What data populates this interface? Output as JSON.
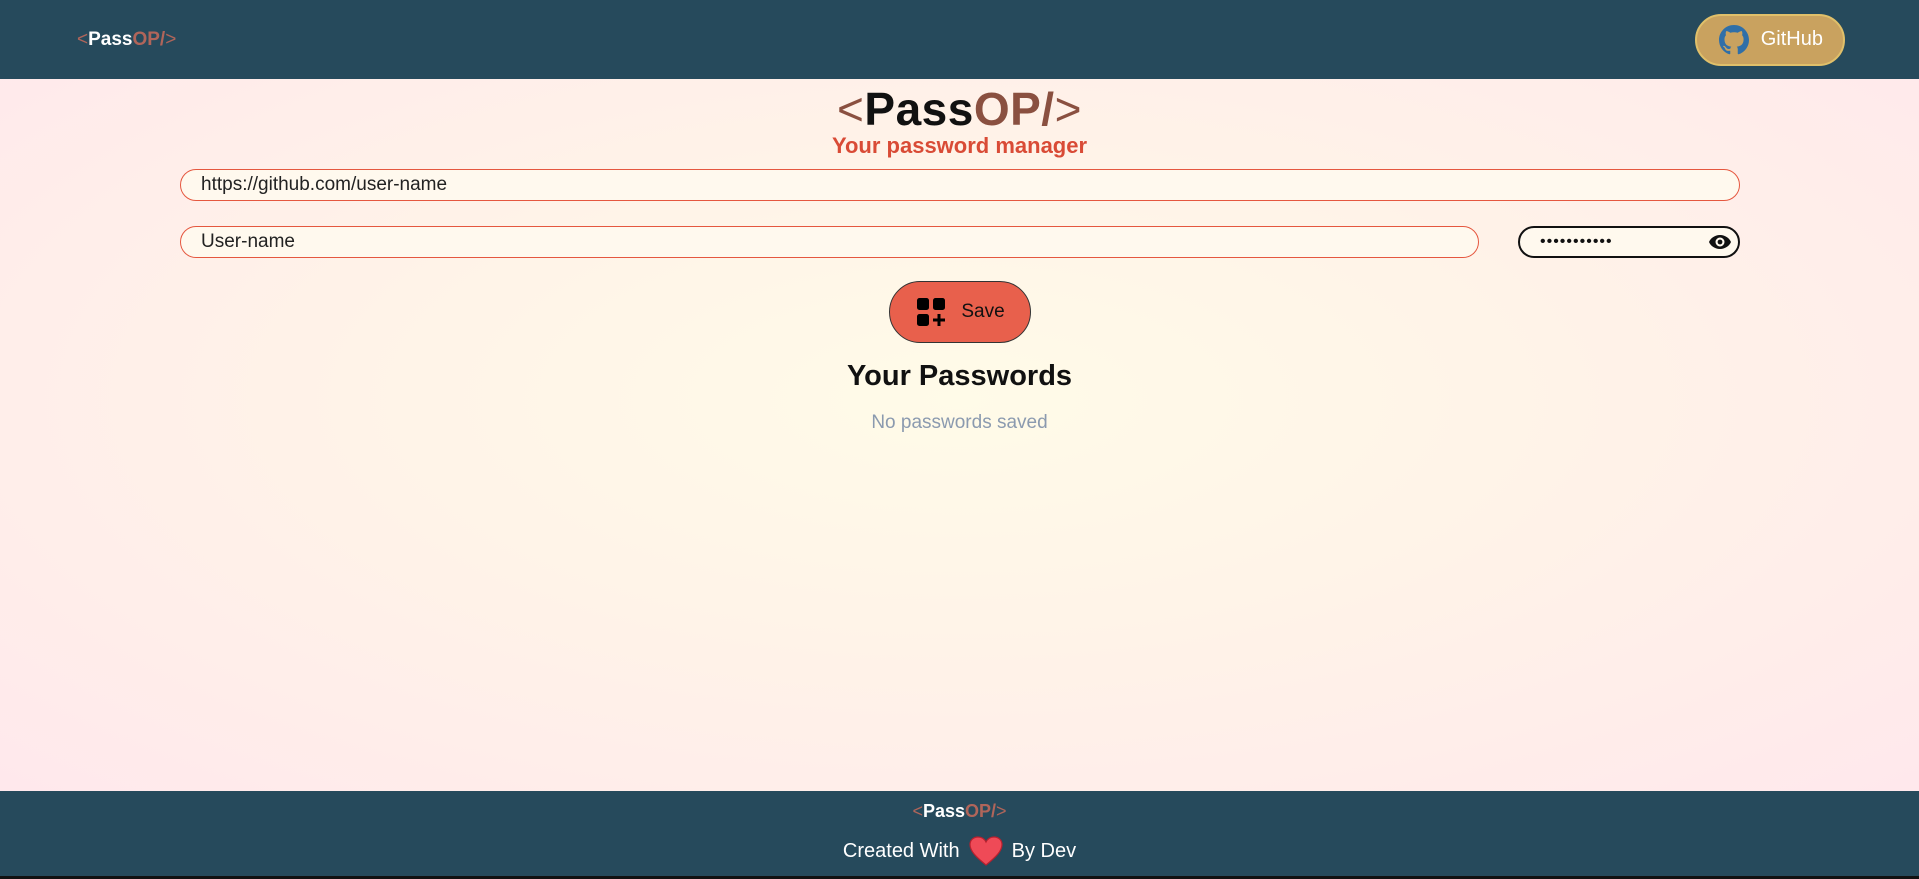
{
  "navbar": {
    "logo": {
      "open": "<",
      "pass": "Pass",
      "op": "OP/",
      "close": ">"
    },
    "github_label": "GitHub"
  },
  "brand": {
    "open": "<",
    "pass": "Pass",
    "op": "OP/",
    "close": ">"
  },
  "tagline": "Your password manager",
  "form": {
    "url_value": "https://github.com/user-name",
    "username_value": "User-name",
    "password_mask": "•••••••••••",
    "save_label": "Save"
  },
  "passwords": {
    "title": "Your Passwords",
    "empty_message": "No passwords saved"
  },
  "footer": {
    "logo": {
      "open": "<",
      "pass": "Pass",
      "op": "OP/",
      "close": ">"
    },
    "credit_before": "Created With",
    "credit_after": "By Dev"
  },
  "colors": {
    "nav_bg": "#264a5c",
    "accent": "#e8604c",
    "github_btn": "#c9a25f",
    "tagline": "#d94b36"
  },
  "icons": [
    "github-icon",
    "eye-icon",
    "add-grid-icon",
    "heart-icon"
  ]
}
